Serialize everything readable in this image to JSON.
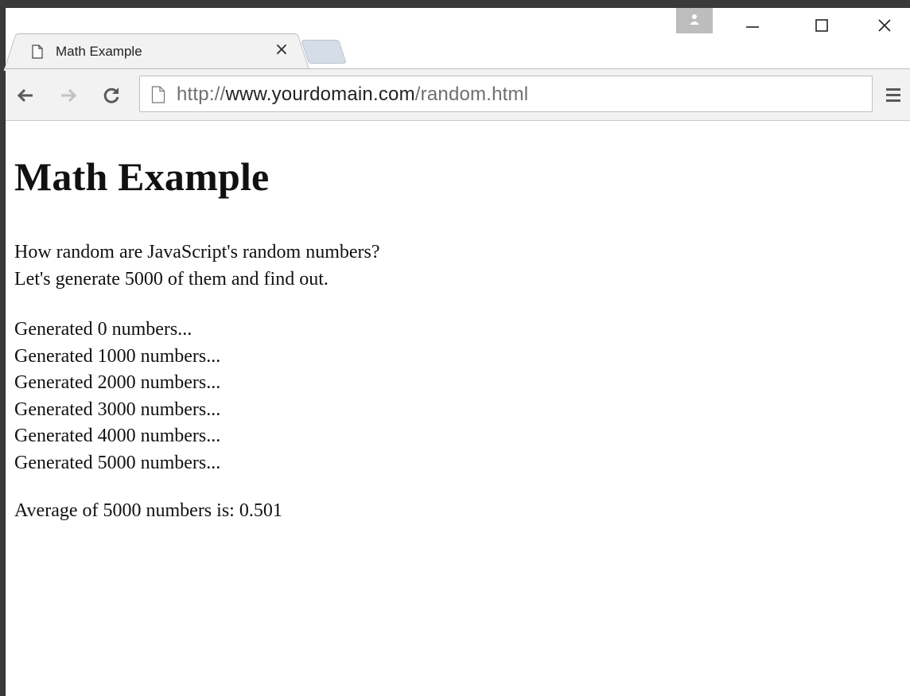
{
  "browser": {
    "tab": {
      "title": "Math Example",
      "close_symbol": "×",
      "favicon": "page-icon"
    },
    "window_controls": {
      "profile": "profile-icon",
      "minimize": "minimize-icon",
      "maximize": "maximize-icon",
      "close": "close-icon"
    },
    "toolbar": {
      "back": "back-arrow-icon",
      "forward": "forward-arrow-icon",
      "reload": "reload-icon",
      "menu": "hamburger-menu-icon"
    },
    "address_bar": {
      "scheme": "http://",
      "host": "www.yourdomain.com",
      "path": "/random.html"
    }
  },
  "page": {
    "heading": "Math Example",
    "intro": [
      "How random are JavaScript's random numbers?",
      "Let's generate 5000 of them and find out."
    ],
    "progress": [
      "Generated 0 numbers...",
      "Generated 1000 numbers...",
      "Generated 2000 numbers...",
      "Generated 3000 numbers...",
      "Generated 4000 numbers...",
      "Generated 5000 numbers..."
    ],
    "result": "Average of 5000 numbers is: 0.501"
  },
  "colors": {
    "frame": "#3a3a3a",
    "toolbar_bg": "#f2f2f2",
    "page_bg": "#ffffff",
    "text": "#111111",
    "url_dim": "#6f6f6f"
  }
}
